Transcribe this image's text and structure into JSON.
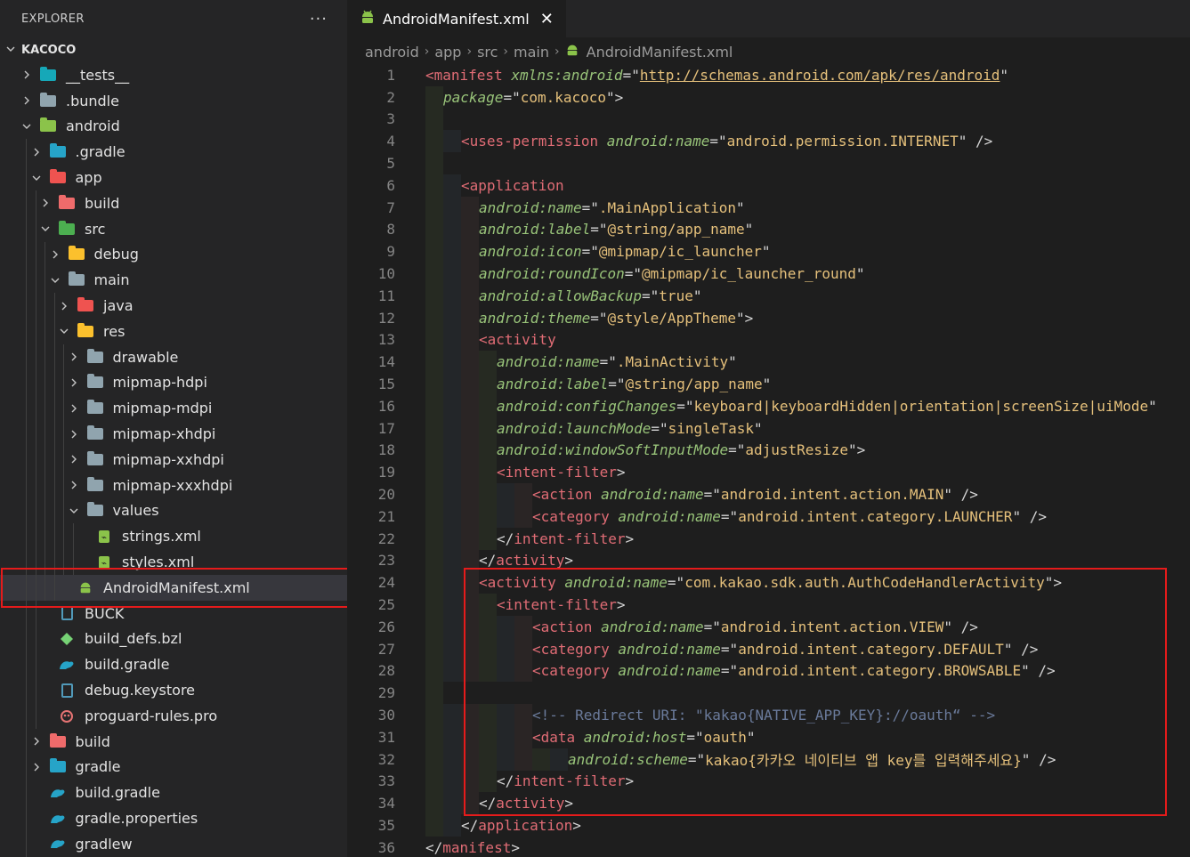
{
  "explorer": {
    "title": "EXPLORER",
    "more": "···",
    "root": "KACOCO"
  },
  "tree": [
    {
      "label": "__tests__",
      "depth": 0,
      "chev": "right",
      "icon": "tests-folder",
      "color": "#16a8b8"
    },
    {
      "label": ".bundle",
      "depth": 0,
      "chev": "right",
      "icon": "folder",
      "color": "#90a4ae"
    },
    {
      "label": "android",
      "depth": 0,
      "chev": "down",
      "icon": "android-folder",
      "color": "#8bc34a"
    },
    {
      "label": ".gradle",
      "depth": 1,
      "chev": "right",
      "icon": "gradle-folder",
      "color": "#26a4c8"
    },
    {
      "label": "app",
      "depth": 1,
      "chev": "down",
      "icon": "app-folder",
      "color": "#ef5350"
    },
    {
      "label": "build",
      "depth": 2,
      "chev": "right",
      "icon": "build-folder",
      "color": "#ef6b6b"
    },
    {
      "label": "src",
      "depth": 2,
      "chev": "down",
      "icon": "src-folder",
      "color": "#4caf50"
    },
    {
      "label": "debug",
      "depth": 3,
      "chev": "right",
      "icon": "debug-folder",
      "color": "#fbc02d"
    },
    {
      "label": "main",
      "depth": 3,
      "chev": "down",
      "icon": "folder-open",
      "color": "#90a4ae"
    },
    {
      "label": "java",
      "depth": 4,
      "chev": "right",
      "icon": "java-folder",
      "color": "#ef5350"
    },
    {
      "label": "res",
      "depth": 4,
      "chev": "down",
      "icon": "res-folder",
      "color": "#fbc02d"
    },
    {
      "label": "drawable",
      "depth": 5,
      "chev": "right",
      "icon": "folder",
      "color": "#90a4ae"
    },
    {
      "label": "mipmap-hdpi",
      "depth": 5,
      "chev": "right",
      "icon": "folder",
      "color": "#90a4ae"
    },
    {
      "label": "mipmap-mdpi",
      "depth": 5,
      "chev": "right",
      "icon": "folder",
      "color": "#90a4ae"
    },
    {
      "label": "mipmap-xhdpi",
      "depth": 5,
      "chev": "right",
      "icon": "folder",
      "color": "#90a4ae"
    },
    {
      "label": "mipmap-xxhdpi",
      "depth": 5,
      "chev": "right",
      "icon": "folder",
      "color": "#90a4ae"
    },
    {
      "label": "mipmap-xxxhdpi",
      "depth": 5,
      "chev": "right",
      "icon": "folder",
      "color": "#90a4ae"
    },
    {
      "label": "values",
      "depth": 5,
      "chev": "down",
      "icon": "folder-open",
      "color": "#90a4ae"
    },
    {
      "label": "strings.xml",
      "depth": 6,
      "chev": "none",
      "icon": "xml-file",
      "color": "#8bc34a"
    },
    {
      "label": "styles.xml",
      "depth": 6,
      "chev": "none",
      "icon": "xml-file",
      "color": "#8bc34a"
    },
    {
      "label": "AndroidManifest.xml",
      "depth": 4,
      "chev": "none",
      "icon": "android-file",
      "color": "#8bc34a",
      "selected": true
    },
    {
      "label": "BUCK",
      "depth": 2,
      "chev": "none",
      "icon": "file",
      "color": "#519aba"
    },
    {
      "label": "build_defs.bzl",
      "depth": 2,
      "chev": "none",
      "icon": "bazel-file",
      "color": "#76d275"
    },
    {
      "label": "build.gradle",
      "depth": 2,
      "chev": "none",
      "icon": "gradle-file",
      "color": "#26a4c8"
    },
    {
      "label": "debug.keystore",
      "depth": 2,
      "chev": "none",
      "icon": "file",
      "color": "#519aba"
    },
    {
      "label": "proguard-rules.pro",
      "depth": 2,
      "chev": "none",
      "icon": "proguard-file",
      "color": "#e57373"
    },
    {
      "label": "build",
      "depth": 1,
      "chev": "right",
      "icon": "build-folder",
      "color": "#ef6b6b"
    },
    {
      "label": "gradle",
      "depth": 1,
      "chev": "right",
      "icon": "gradle-folder",
      "color": "#26a4c8"
    },
    {
      "label": "build.gradle",
      "depth": 1,
      "chev": "none",
      "icon": "gradle-file",
      "color": "#26a4c8"
    },
    {
      "label": "gradle.properties",
      "depth": 1,
      "chev": "none",
      "icon": "gradle-file",
      "color": "#26a4c8"
    },
    {
      "label": "gradlew",
      "depth": 1,
      "chev": "none",
      "icon": "gradle-file",
      "color": "#26a4c8"
    }
  ],
  "tab": {
    "label": "AndroidManifest.xml",
    "close": "✕"
  },
  "breadcrumbs": [
    "android",
    "app",
    "src",
    "main",
    "AndroidManifest.xml"
  ],
  "code": [
    {
      "n": "1",
      "i": 0,
      "t": [
        [
          "tg",
          "<manifest "
        ],
        [
          "an",
          "xmlns:android"
        ],
        [
          "pu",
          "=\""
        ],
        [
          "av link",
          "http://schemas.android.com/apk/res/android"
        ],
        [
          "pu",
          "\""
        ]
      ]
    },
    {
      "n": "2",
      "i": 1,
      "t": [
        [
          "an",
          "package"
        ],
        [
          "pu",
          "=\""
        ],
        [
          "av",
          "com.kacoco"
        ],
        [
          "pu",
          "\">"
        ]
      ]
    },
    {
      "n": "3",
      "i": 1,
      "t": []
    },
    {
      "n": "4",
      "i": 2,
      "t": [
        [
          "tg",
          "<uses-permission "
        ],
        [
          "an",
          "android:name"
        ],
        [
          "pu",
          "=\""
        ],
        [
          "av",
          "android.permission.INTERNET"
        ],
        [
          "pu",
          "\" />"
        ]
      ]
    },
    {
      "n": "5",
      "i": 1,
      "t": []
    },
    {
      "n": "6",
      "i": 2,
      "t": [
        [
          "tg",
          "<application"
        ]
      ]
    },
    {
      "n": "7",
      "i": 3,
      "t": [
        [
          "an",
          "android:name"
        ],
        [
          "pu",
          "=\""
        ],
        [
          "av",
          ".MainApplication"
        ],
        [
          "pu",
          "\""
        ]
      ]
    },
    {
      "n": "8",
      "i": 3,
      "t": [
        [
          "an",
          "android:label"
        ],
        [
          "pu",
          "=\""
        ],
        [
          "av",
          "@string/app_name"
        ],
        [
          "pu",
          "\""
        ]
      ]
    },
    {
      "n": "9",
      "i": 3,
      "t": [
        [
          "an",
          "android:icon"
        ],
        [
          "pu",
          "=\""
        ],
        [
          "av",
          "@mipmap/ic_launcher"
        ],
        [
          "pu",
          "\""
        ]
      ]
    },
    {
      "n": "10",
      "i": 3,
      "t": [
        [
          "an",
          "android:roundIcon"
        ],
        [
          "pu",
          "=\""
        ],
        [
          "av",
          "@mipmap/ic_launcher_round"
        ],
        [
          "pu",
          "\""
        ]
      ]
    },
    {
      "n": "11",
      "i": 3,
      "t": [
        [
          "an",
          "android:allowBackup"
        ],
        [
          "pu",
          "=\""
        ],
        [
          "av",
          "true"
        ],
        [
          "pu",
          "\""
        ]
      ]
    },
    {
      "n": "12",
      "i": 3,
      "t": [
        [
          "an",
          "android:theme"
        ],
        [
          "pu",
          "=\""
        ],
        [
          "av",
          "@style/AppTheme"
        ],
        [
          "pu",
          "\">"
        ]
      ]
    },
    {
      "n": "13",
      "i": 3,
      "t": [
        [
          "tg",
          "<activity"
        ]
      ]
    },
    {
      "n": "14",
      "i": 4,
      "t": [
        [
          "an",
          "android:name"
        ],
        [
          "pu",
          "=\""
        ],
        [
          "av",
          ".MainActivity"
        ],
        [
          "pu",
          "\""
        ]
      ]
    },
    {
      "n": "15",
      "i": 4,
      "t": [
        [
          "an",
          "android:label"
        ],
        [
          "pu",
          "=\""
        ],
        [
          "av",
          "@string/app_name"
        ],
        [
          "pu",
          "\""
        ]
      ]
    },
    {
      "n": "16",
      "i": 4,
      "t": [
        [
          "an",
          "android:configChanges"
        ],
        [
          "pu",
          "=\""
        ],
        [
          "av",
          "keyboard|keyboardHidden|orientation|screenSize|uiMode"
        ],
        [
          "pu",
          "\""
        ]
      ]
    },
    {
      "n": "17",
      "i": 4,
      "t": [
        [
          "an",
          "android:launchMode"
        ],
        [
          "pu",
          "=\""
        ],
        [
          "av",
          "singleTask"
        ],
        [
          "pu",
          "\""
        ]
      ]
    },
    {
      "n": "18",
      "i": 4,
      "t": [
        [
          "an",
          "android:windowSoftInputMode"
        ],
        [
          "pu",
          "=\""
        ],
        [
          "av",
          "adjustResize"
        ],
        [
          "pu",
          "\">"
        ]
      ]
    },
    {
      "n": "19",
      "i": 4,
      "t": [
        [
          "tg",
          "<intent-filter"
        ],
        [
          "pu",
          ">"
        ]
      ]
    },
    {
      "n": "20",
      "i": 6,
      "t": [
        [
          "tg",
          "<action "
        ],
        [
          "an",
          "android:name"
        ],
        [
          "pu",
          "=\""
        ],
        [
          "av",
          "android.intent.action.MAIN"
        ],
        [
          "pu",
          "\" />"
        ]
      ]
    },
    {
      "n": "21",
      "i": 6,
      "t": [
        [
          "tg",
          "<category "
        ],
        [
          "an",
          "android:name"
        ],
        [
          "pu",
          "=\""
        ],
        [
          "av",
          "android.intent.category.LAUNCHER"
        ],
        [
          "pu",
          "\" />"
        ]
      ]
    },
    {
      "n": "22",
      "i": 4,
      "t": [
        [
          "pu",
          "</"
        ],
        [
          "tg",
          "intent-filter"
        ],
        [
          "pu",
          ">"
        ]
      ]
    },
    {
      "n": "23",
      "i": 3,
      "t": [
        [
          "pu",
          "</"
        ],
        [
          "tg",
          "activity"
        ],
        [
          "pu",
          ">"
        ]
      ]
    },
    {
      "n": "24",
      "i": 3,
      "t": [
        [
          "tg",
          "<activity "
        ],
        [
          "an",
          "android:name"
        ],
        [
          "pu",
          "=\""
        ],
        [
          "av",
          "com.kakao.sdk.auth.AuthCodeHandlerActivity"
        ],
        [
          "pu",
          "\">"
        ]
      ]
    },
    {
      "n": "25",
      "i": 4,
      "t": [
        [
          "tg",
          "<intent-filter"
        ],
        [
          "pu",
          ">"
        ]
      ]
    },
    {
      "n": "26",
      "i": 6,
      "t": [
        [
          "tg",
          "<action "
        ],
        [
          "an",
          "android:name"
        ],
        [
          "pu",
          "=\""
        ],
        [
          "av",
          "android.intent.action.VIEW"
        ],
        [
          "pu",
          "\" />"
        ]
      ]
    },
    {
      "n": "27",
      "i": 6,
      "t": [
        [
          "tg",
          "<category "
        ],
        [
          "an",
          "android:name"
        ],
        [
          "pu",
          "=\""
        ],
        [
          "av",
          "android.intent.category.DEFAULT"
        ],
        [
          "pu",
          "\" />"
        ]
      ]
    },
    {
      "n": "28",
      "i": 6,
      "t": [
        [
          "tg",
          "<category "
        ],
        [
          "an",
          "android:name"
        ],
        [
          "pu",
          "=\""
        ],
        [
          "av",
          "android.intent.category.BROWSABLE"
        ],
        [
          "pu",
          "\" />"
        ]
      ]
    },
    {
      "n": "29",
      "i": 1,
      "t": []
    },
    {
      "n": "30",
      "i": 6,
      "t": [
        [
          "cm",
          "<!-- Redirect URI: \"kakao{NATIVE_APP_KEY}://oauth“ -->"
        ]
      ]
    },
    {
      "n": "31",
      "i": 6,
      "t": [
        [
          "tg",
          "<data "
        ],
        [
          "an",
          "android:host"
        ],
        [
          "pu",
          "=\""
        ],
        [
          "av",
          "oauth"
        ],
        [
          "pu",
          "\""
        ]
      ]
    },
    {
      "n": "32",
      "i": 8,
      "t": [
        [
          "an",
          "android:scheme"
        ],
        [
          "pu",
          "=\""
        ],
        [
          "av",
          "kakao{카카오 네이티브 앱 key를 입력해주세요}"
        ],
        [
          "pu",
          "\" />"
        ]
      ]
    },
    {
      "n": "33",
      "i": 4,
      "t": [
        [
          "pu",
          "</"
        ],
        [
          "tg",
          "intent-filter"
        ],
        [
          "pu",
          ">"
        ]
      ]
    },
    {
      "n": "34",
      "i": 3,
      "t": [
        [
          "pu",
          "</"
        ],
        [
          "tg",
          "activity"
        ],
        [
          "pu",
          ">"
        ]
      ]
    },
    {
      "n": "35",
      "i": 2,
      "t": [
        [
          "pu",
          "</"
        ],
        [
          "tg",
          "application"
        ],
        [
          "pu",
          ">"
        ]
      ]
    },
    {
      "n": "36",
      "i": 0,
      "t": [
        [
          "pu",
          "</"
        ],
        [
          "tg",
          "manifest"
        ],
        [
          "pu",
          ">"
        ]
      ]
    }
  ]
}
